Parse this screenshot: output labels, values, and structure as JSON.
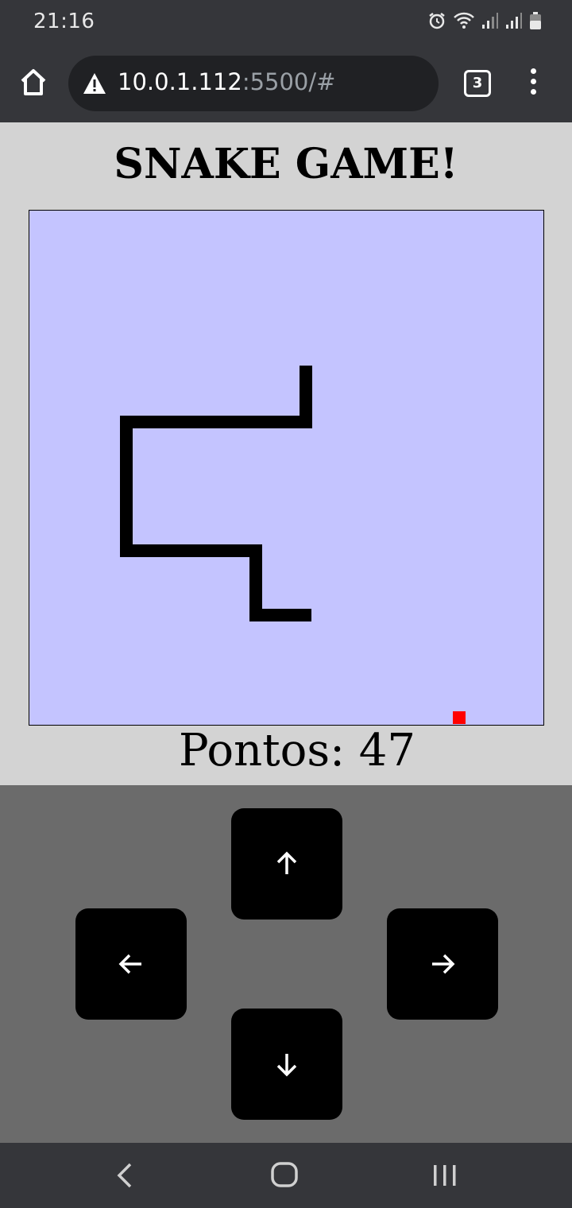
{
  "status_bar": {
    "time": "21:16",
    "icons": [
      "alarm-icon",
      "wifi-icon",
      "signal-icon",
      "signal-icon",
      "battery-icon"
    ]
  },
  "browser": {
    "url_host": "10.0.1.112",
    "url_rest": ":5500/#",
    "tab_count": "3",
    "icons": [
      "home-icon",
      "warning-icon",
      "tabs-icon",
      "menu-icon"
    ]
  },
  "game": {
    "title": "SNAKE GAME!",
    "score_label": "Pontos: 47",
    "board_color": "#c4c4ff",
    "snake_color": "#000000",
    "food_color": "#ff0000"
  },
  "controls": {
    "buttons": [
      "up-arrow-icon",
      "left-arrow-icon",
      "right-arrow-icon",
      "down-arrow-icon"
    ]
  },
  "nav_bar": {
    "icons": [
      "back-icon",
      "home-circle-icon",
      "recent-apps-icon"
    ]
  }
}
